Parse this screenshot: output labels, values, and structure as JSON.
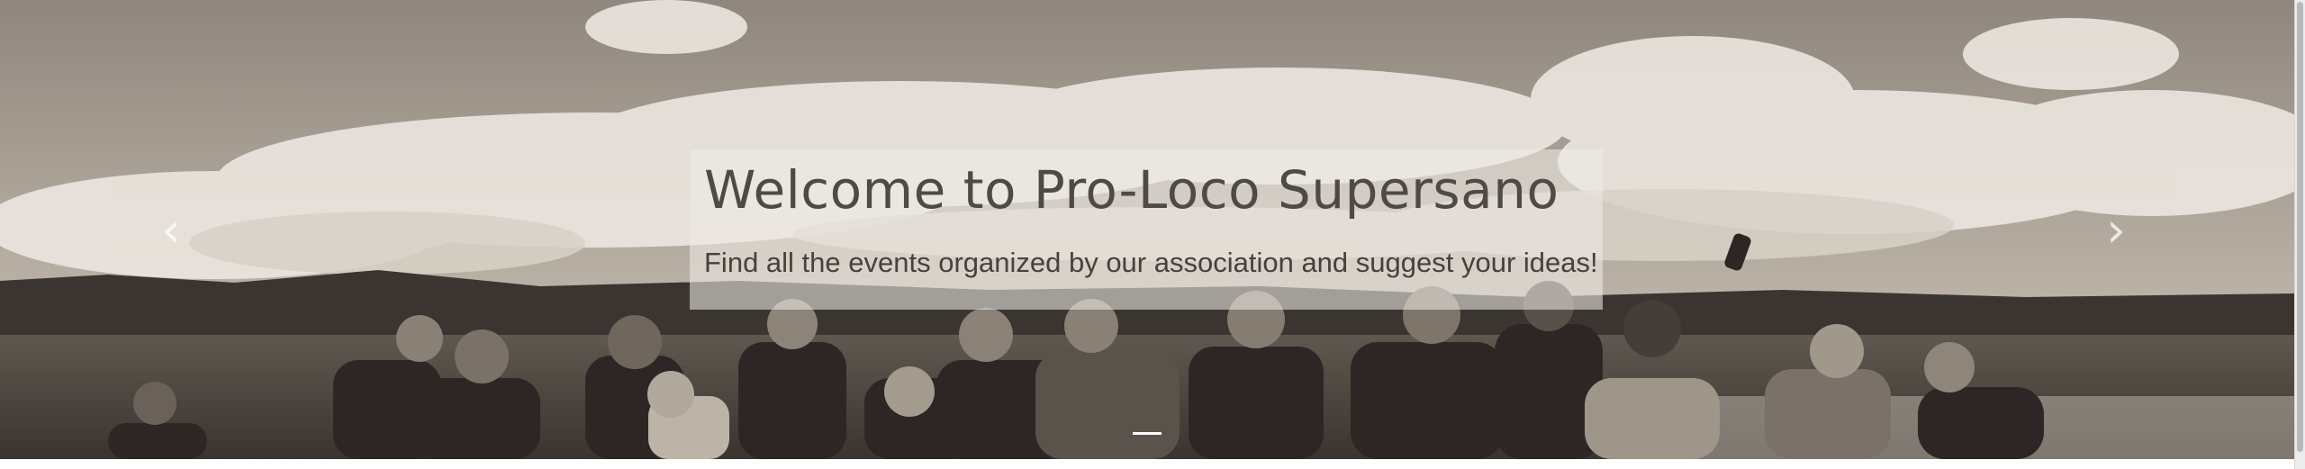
{
  "carousel": {
    "caption": {
      "title": "Welcome to Pro-Loco Supersano",
      "text": "Find all the events organized by our association and suggest your ideas!"
    },
    "prev_icon": "chevron-left-icon",
    "next_icon": "chevron-right-icon",
    "indicators": {
      "count": 1,
      "active": 0
    }
  },
  "colors": {
    "sky": "#a59c90",
    "clouds": "#eeebe5",
    "caption_background": "#eeebe6",
    "title_text": "#4e4a44",
    "body_text": "#45413b"
  }
}
